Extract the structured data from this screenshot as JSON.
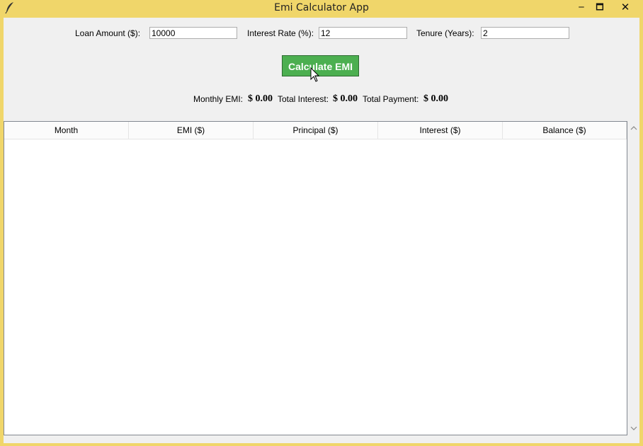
{
  "window": {
    "title": "Emi Calculator App",
    "minimize": "‒",
    "maximize": "🗖",
    "close": "✕"
  },
  "form": {
    "loan_label": "Loan Amount ($):",
    "loan_value": "10000",
    "rate_label": "Interest Rate (%):",
    "rate_value": "12",
    "tenure_label": "Tenure (Years):",
    "tenure_value": "2",
    "calculate_label": "Calculate EMI"
  },
  "results": {
    "monthly_label": "Monthly EMI:",
    "monthly_value": "$ 0.00",
    "interest_label": "Total Interest:",
    "interest_value": "$ 0.00",
    "payment_label": "Total Payment:",
    "payment_value": "$ 0.00"
  },
  "table": {
    "columns": [
      "Month",
      "EMI ($)",
      "Principal ($)",
      "Interest ($)",
      "Balance ($)"
    ],
    "rows": []
  },
  "colors": {
    "titlebar": "#f0d66a",
    "button": "#4caf50"
  },
  "icons": {
    "app": "feather-icon",
    "cursor": "mouse-pointer-icon",
    "scroll_up": "chevron-up-icon",
    "scroll_down": "chevron-down-icon"
  }
}
